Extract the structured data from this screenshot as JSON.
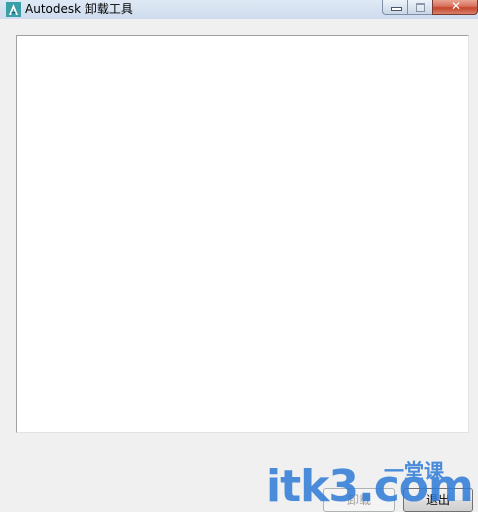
{
  "window": {
    "title": "Autodesk 卸载工具"
  },
  "caption_buttons": {
    "close_glyph": "✕"
  },
  "log": {
    "text": ""
  },
  "buttons": {
    "uninstall_label": "卸载",
    "exit_label": "退出"
  },
  "watermark": {
    "main": "itk3",
    "dot_com": ".com",
    "sub": "一堂课"
  },
  "colors": {
    "accent": "#2e7bd6",
    "close_button": "#c4452b",
    "app_icon_bg": "#3a9fa6"
  }
}
